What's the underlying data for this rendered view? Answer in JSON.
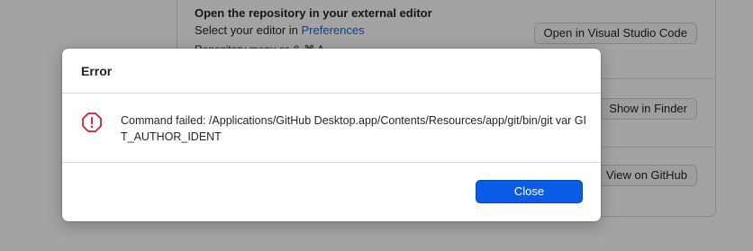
{
  "background": {
    "editor_section": {
      "title": "Open the repository in your external editor",
      "subtitle_prefix": "Select your editor in ",
      "subtitle_link": "Preferences",
      "partial_text": "Repository menu  or  ⇧ ⌘ A",
      "button_label": "Open in Visual Studio Code"
    },
    "finder_section": {
      "button_label": "Show in Finder"
    },
    "github_section": {
      "button_label": "View on GitHub"
    }
  },
  "dialog": {
    "title": "Error",
    "icon": "octagon-alert-icon",
    "message": "Command failed: /Applications/GitHub Desktop.app/Contents/Resources/app/git/bin/git var GIT_AUTHOR_IDENT",
    "close_label": "Close",
    "colors": {
      "accent": "#0a5ce6",
      "error": "#cf222e"
    }
  }
}
